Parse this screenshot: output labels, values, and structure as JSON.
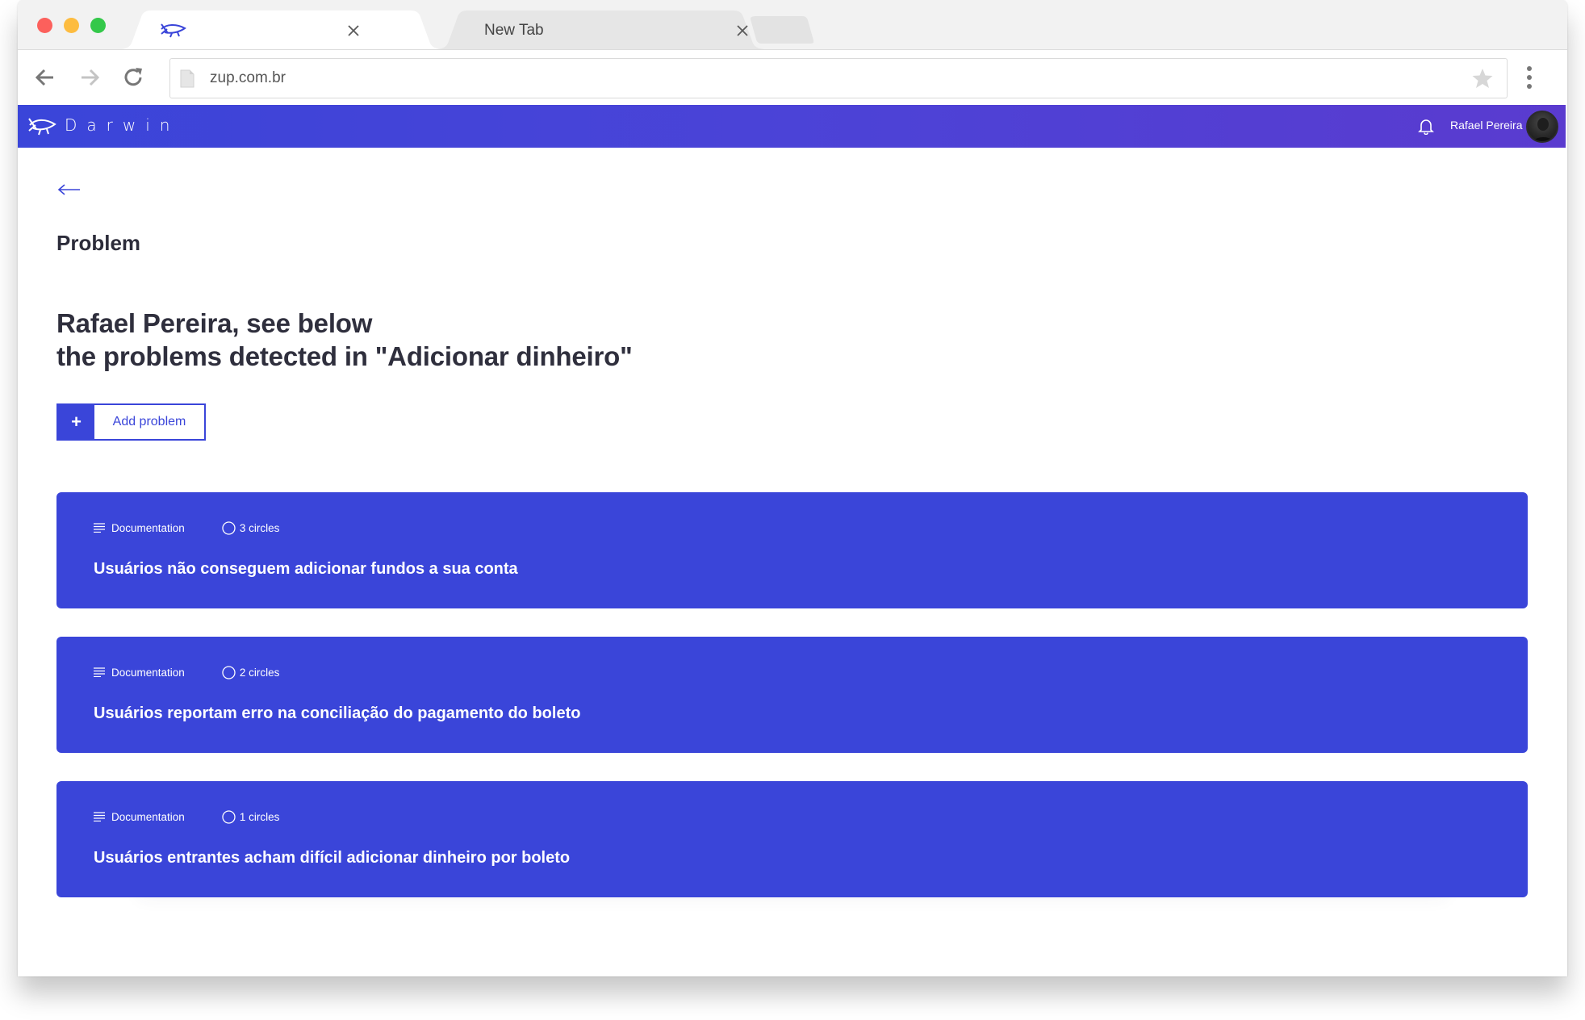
{
  "browser": {
    "tabs": [
      {
        "label": "",
        "icon": "darwin-logo-icon",
        "active": true
      },
      {
        "label": "New Tab",
        "icon": "",
        "active": false
      }
    ],
    "url": "zup.com.br"
  },
  "header": {
    "brand": "Darwin",
    "user_name": "Rafael Pereira",
    "colors": {
      "gradient_start": "#3a45d9",
      "gradient_end": "#5a3bcf"
    }
  },
  "page": {
    "title": "Problem",
    "headline_line1": "Rafael Pereira, see below",
    "headline_line2": "the problems detected in \"Adicionar dinheiro\"",
    "add_button_icon": "+",
    "add_button_label": "Add problem",
    "accent_color": "#3a45d9"
  },
  "problems": [
    {
      "category": "Documentation",
      "circles": "3 circles",
      "title": "Usuários não conseguem adicionar fundos a sua conta"
    },
    {
      "category": "Documentation",
      "circles": "2 circles",
      "title": "Usuários reportam erro na conciliação do pagamento do boleto"
    },
    {
      "category": "Documentation",
      "circles": "1 circles",
      "title": "Usuários entrantes acham difícil adicionar dinheiro por boleto"
    }
  ]
}
